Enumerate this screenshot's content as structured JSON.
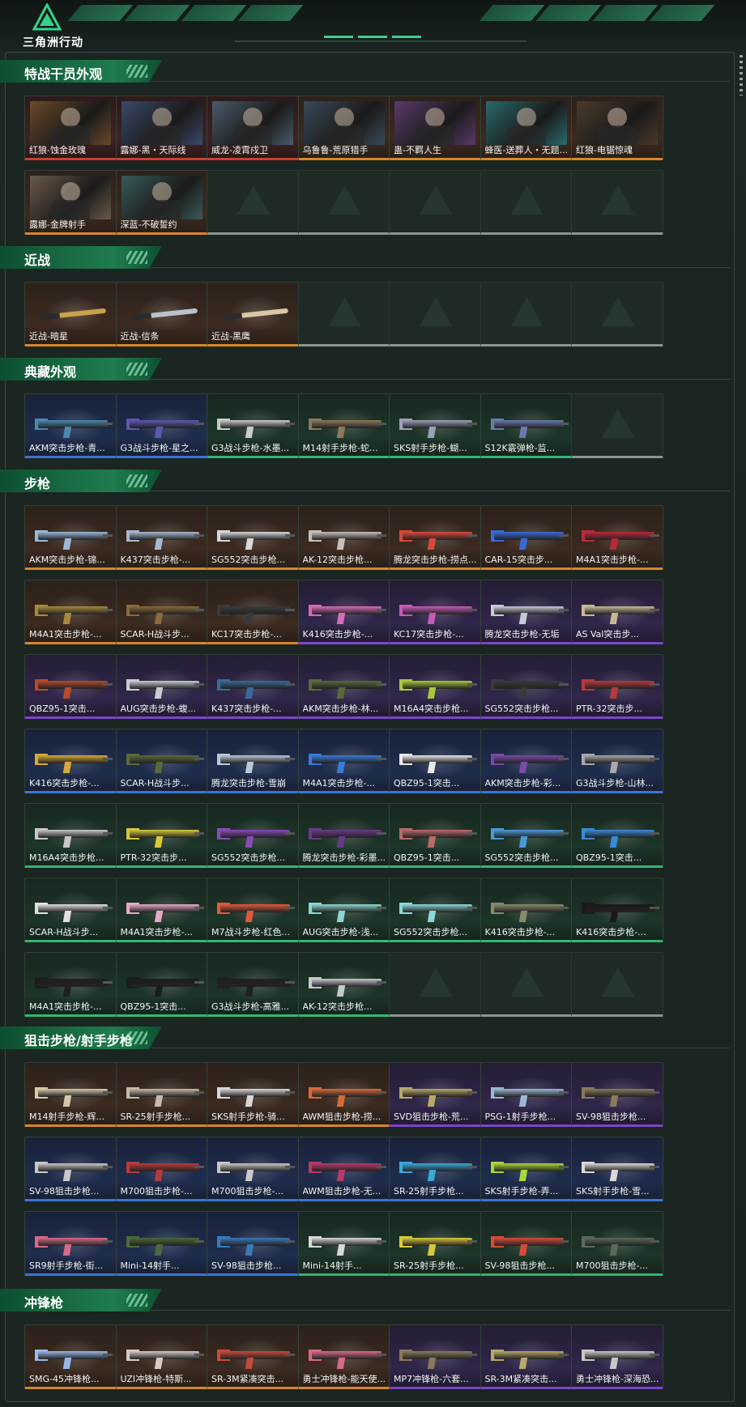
{
  "app": {
    "logo_text": "三角洲行动",
    "accent": "#2fd08a"
  },
  "rarity_colors": {
    "gold": "#d9862a",
    "red": "#c9402f",
    "purple": "#7c46c9",
    "blue": "#3a74d6",
    "green": "#32b771",
    "silver": "#9aa6a0"
  },
  "sections": [
    {
      "title": "特战干员外观",
      "kind": "portrait",
      "items": [
        {
          "label": "红狼-蚀金玫瑰",
          "rarity": "red",
          "icon": "operator-portrait",
          "tint": "#6a4a2a"
        },
        {
          "label": "露娜-黑・天际线",
          "rarity": "red",
          "icon": "operator-portrait",
          "tint": "#3a4a6a"
        },
        {
          "label": "威龙-凌霄戍卫",
          "rarity": "red",
          "icon": "operator-portrait",
          "tint": "#4a5a6a"
        },
        {
          "label": "乌鲁鲁-荒原猎手",
          "rarity": "gold",
          "icon": "operator-portrait",
          "tint": "#3a4a5a"
        },
        {
          "label": "蛊-不羁人生",
          "rarity": "gold",
          "icon": "operator-portrait",
          "tint": "#5a3a6a"
        },
        {
          "label": "蜂医-送葬人・无题...",
          "rarity": "gold",
          "icon": "operator-portrait",
          "tint": "#2a6a6a"
        },
        {
          "label": "红狼-电锯惊魂",
          "rarity": "gold",
          "icon": "operator-portrait",
          "tint": "#4a3a2a"
        },
        {
          "label": "露娜-金牌射手",
          "rarity": "gold",
          "icon": "operator-portrait",
          "tint": "#6a5a4a"
        },
        {
          "label": "深蓝-不破誓约",
          "rarity": "gold",
          "icon": "operator-portrait",
          "tint": "#3a5a5a"
        },
        {
          "label": "",
          "rarity": "empty"
        },
        {
          "label": "",
          "rarity": "empty"
        },
        {
          "label": "",
          "rarity": "empty"
        },
        {
          "label": "",
          "rarity": "empty"
        },
        {
          "label": "",
          "rarity": "empty"
        }
      ]
    },
    {
      "title": "近战",
      "kind": "knife",
      "items": [
        {
          "label": "近战-暗星",
          "rarity": "gold",
          "icon": "knife-icon",
          "tint": "#c9a24a"
        },
        {
          "label": "近战-信条",
          "rarity": "gold",
          "icon": "knife-icon",
          "tint": "#b9c2c8"
        },
        {
          "label": "近战-黑鹰",
          "rarity": "gold",
          "icon": "knife-icon",
          "tint": "#d8c8a8"
        },
        {
          "label": "",
          "rarity": "empty"
        },
        {
          "label": "",
          "rarity": "empty"
        },
        {
          "label": "",
          "rarity": "empty"
        },
        {
          "label": "",
          "rarity": "empty"
        }
      ]
    },
    {
      "title": "典藏外观",
      "kind": "gun",
      "items": [
        {
          "label": "AKM突击步枪-青...",
          "rarity": "blue",
          "icon": "rifle-icon",
          "tint": "#4a8ab0"
        },
        {
          "label": "G3战斗步枪-星之...",
          "rarity": "blue",
          "icon": "rifle-icon",
          "tint": "#5a5ab0"
        },
        {
          "label": "G3战斗步枪-水墨...",
          "rarity": "green",
          "icon": "rifle-icon",
          "tint": "#c8ccc8"
        },
        {
          "label": "M14射手步枪-蛇...",
          "rarity": "green",
          "icon": "rifle-icon",
          "tint": "#8a7a5a"
        },
        {
          "label": "SKS射手步枪-蝴...",
          "rarity": "green",
          "icon": "rifle-icon",
          "tint": "#9aa2b8"
        },
        {
          "label": "S12K霰弹枪-监...",
          "rarity": "green",
          "icon": "shotgun-icon",
          "tint": "#6a7ab0"
        },
        {
          "label": "",
          "rarity": "empty"
        }
      ]
    },
    {
      "title": "步枪",
      "kind": "gun",
      "items": [
        {
          "label": "AKM突击步枪-锦...",
          "rarity": "gold",
          "icon": "rifle-icon",
          "tint": "#9ab8d8"
        },
        {
          "label": "K437突击步枪-...",
          "rarity": "gold",
          "icon": "rifle-icon",
          "tint": "#a8b8d0"
        },
        {
          "label": "SG552突击步枪...",
          "rarity": "gold",
          "icon": "rifle-icon",
          "tint": "#d8d8d8"
        },
        {
          "label": "AK-12突击步枪...",
          "rarity": "gold",
          "icon": "rifle-icon",
          "tint": "#c8c0b8"
        },
        {
          "label": "腾龙突击步枪-捞点...",
          "rarity": "gold",
          "icon": "rifle-icon",
          "tint": "#d84a3a"
        },
        {
          "label": "CAR-15突击步...",
          "rarity": "gold",
          "icon": "rifle-icon",
          "tint": "#3a6ad8"
        },
        {
          "label": "M4A1突击步枪-...",
          "rarity": "gold",
          "icon": "rifle-icon",
          "tint": "#b82a3a"
        },
        {
          "label": "M4A1突击步枪-...",
          "rarity": "gold",
          "icon": "rifle-icon",
          "tint": "#a88a3a"
        },
        {
          "label": "SCAR-H战斗步...",
          "rarity": "gold",
          "icon": "rifle-icon",
          "tint": "#8a6a3a"
        },
        {
          "label": "KC17突击步枪-...",
          "rarity": "gold",
          "icon": "rifle-icon",
          "tint": "#3a3a3a"
        },
        {
          "label": "K416突击步枪-...",
          "rarity": "purple",
          "icon": "rifle-icon",
          "tint": "#d86ab8"
        },
        {
          "label": "KC17突击步枪-...",
          "rarity": "purple",
          "icon": "rifle-icon",
          "tint": "#c85ab8"
        },
        {
          "label": "腾龙突击步枪-无垢",
          "rarity": "purple",
          "icon": "rifle-icon",
          "tint": "#c8c8d8"
        },
        {
          "label": "AS Val突击步...",
          "rarity": "purple",
          "icon": "rifle-icon",
          "tint": "#c8b898"
        },
        {
          "label": "QBZ95-1突击...",
          "rarity": "purple",
          "icon": "rifle-icon",
          "tint": "#b84a2a"
        },
        {
          "label": "AUG突击步枪-蝮...",
          "rarity": "purple",
          "icon": "rifle-icon",
          "tint": "#c8ccd0"
        },
        {
          "label": "K437突击步枪-...",
          "rarity": "purple",
          "icon": "rifle-icon",
          "tint": "#3a6a9a"
        },
        {
          "label": "AKM突击步枪-林...",
          "rarity": "purple",
          "icon": "rifle-icon",
          "tint": "#5a6a3a"
        },
        {
          "label": "M16A4突击步枪...",
          "rarity": "purple",
          "icon": "rifle-icon",
          "tint": "#a8c83a"
        },
        {
          "label": "SG552突击步枪...",
          "rarity": "purple",
          "icon": "rifle-icon",
          "tint": "#3a3a3a"
        },
        {
          "label": "PTR-32突击步...",
          "rarity": "purple",
          "icon": "rifle-icon",
          "tint": "#b83a3a"
        },
        {
          "label": "K416突击步枪-...",
          "rarity": "blue",
          "icon": "rifle-icon",
          "tint": "#d8a83a"
        },
        {
          "label": "SCAR-H战斗步...",
          "rarity": "blue",
          "icon": "rifle-icon",
          "tint": "#5a6a3a"
        },
        {
          "label": "腾龙突击步枪-雪崩",
          "rarity": "blue",
          "icon": "rifle-icon",
          "tint": "#b8c8d8"
        },
        {
          "label": "M4A1突击步枪-...",
          "rarity": "blue",
          "icon": "rifle-icon",
          "tint": "#3a7ad8"
        },
        {
          "label": "QBZ95-1突击...",
          "rarity": "blue",
          "icon": "rifle-icon",
          "tint": "#e8e8e8"
        },
        {
          "label": "AKM突击步枪-彩...",
          "rarity": "blue",
          "icon": "rifle-icon",
          "tint": "#7a4aa8"
        },
        {
          "label": "G3战斗步枪-山林...",
          "rarity": "blue",
          "icon": "rifle-icon",
          "tint": "#a8a8a8"
        },
        {
          "label": "M16A4突击步枪...",
          "rarity": "green",
          "icon": "rifle-icon",
          "tint": "#c8c8c8"
        },
        {
          "label": "PTR-32突击步...",
          "rarity": "green",
          "icon": "rifle-icon",
          "tint": "#d8c83a"
        },
        {
          "label": "SG552突击步枪...",
          "rarity": "green",
          "icon": "rifle-icon",
          "tint": "#8a4ab8"
        },
        {
          "label": "腾龙突击步枪-彩墨...",
          "rarity": "green",
          "icon": "rifle-icon",
          "tint": "#6a3a8a"
        },
        {
          "label": "QBZ95-1突击...",
          "rarity": "green",
          "icon": "rifle-icon",
          "tint": "#b86a6a"
        },
        {
          "label": "SG552突击步枪...",
          "rarity": "green",
          "icon": "rifle-icon",
          "tint": "#4a9ad8"
        },
        {
          "label": "QBZ95-1突击...",
          "rarity": "green",
          "icon": "rifle-icon",
          "tint": "#3a8ad8"
        },
        {
          "label": "SCAR-H战斗步...",
          "rarity": "green",
          "icon": "rifle-icon",
          "tint": "#e0e0e0"
        },
        {
          "label": "M4A1突击步枪-...",
          "rarity": "green",
          "icon": "rifle-icon",
          "tint": "#e8a8c8"
        },
        {
          "label": "M7战斗步枪-红色...",
          "rarity": "green",
          "icon": "rifle-icon",
          "tint": "#e05a3a"
        },
        {
          "label": "AUG突击步枪-浅...",
          "rarity": "green",
          "icon": "rifle-icon",
          "tint": "#8ad8d0"
        },
        {
          "label": "SG552突击步枪...",
          "rarity": "green",
          "icon": "rifle-icon",
          "tint": "#8ad8d8"
        },
        {
          "label": "K416突击步枪-...",
          "rarity": "green",
          "icon": "rifle-icon",
          "tint": "#8a8a6a"
        },
        {
          "label": "K416突击步枪-...",
          "rarity": "green",
          "icon": "rifle-icon",
          "tint": "#1a1a1a"
        },
        {
          "label": "M4A1突击步枪-...",
          "rarity": "green",
          "icon": "rifle-icon",
          "tint": "#1e1e1e"
        },
        {
          "label": "QBZ95-1突击...",
          "rarity": "green",
          "icon": "rifle-icon",
          "tint": "#1c1c1c"
        },
        {
          "label": "G3战斗步枪-高雅...",
          "rarity": "green",
          "icon": "rifle-icon",
          "tint": "#202020"
        },
        {
          "label": "AK-12突击步枪...",
          "rarity": "green",
          "icon": "rifle-icon",
          "tint": "#c8c8d0"
        },
        {
          "label": "",
          "rarity": "empty"
        },
        {
          "label": "",
          "rarity": "empty"
        },
        {
          "label": "",
          "rarity": "empty"
        }
      ]
    },
    {
      "title": "狙击步枪/射手步枪",
      "kind": "gun",
      "items": [
        {
          "label": "M14射手步枪-辉...",
          "rarity": "gold",
          "icon": "sniper-icon",
          "tint": "#d8c8a8"
        },
        {
          "label": "SR-25射手步枪...",
          "rarity": "gold",
          "icon": "sniper-icon",
          "tint": "#c8b8a8"
        },
        {
          "label": "SKS射手步枪-骑...",
          "rarity": "gold",
          "icon": "sniper-icon",
          "tint": "#d8d8d8"
        },
        {
          "label": "AWM狙击步枪-捞...",
          "rarity": "gold",
          "icon": "sniper-icon",
          "tint": "#d86a3a"
        },
        {
          "label": "SVD狙击步枪-荒...",
          "rarity": "purple",
          "icon": "sniper-icon",
          "tint": "#b8a86a"
        },
        {
          "label": "PSG-1射手步枪...",
          "rarity": "purple",
          "icon": "sniper-icon",
          "tint": "#9ab8d8"
        },
        {
          "label": "SV-98狙击步枪...",
          "rarity": "purple",
          "icon": "sniper-icon",
          "tint": "#8a7a5a"
        },
        {
          "label": "SV-98狙击步枪...",
          "rarity": "blue",
          "icon": "sniper-icon",
          "tint": "#c8c8c8"
        },
        {
          "label": "M700狙击步枪-...",
          "rarity": "blue",
          "icon": "sniper-icon",
          "tint": "#b83a3a"
        },
        {
          "label": "M700狙击步枪-...",
          "rarity": "blue",
          "icon": "sniper-icon",
          "tint": "#c8c8c8"
        },
        {
          "label": "AWM狙击步枪-无...",
          "rarity": "blue",
          "icon": "sniper-icon",
          "tint": "#b83a6a"
        },
        {
          "label": "SR-25射手步枪...",
          "rarity": "blue",
          "icon": "sniper-icon",
          "tint": "#3aa8d8"
        },
        {
          "label": "SKS射手步枪-弄...",
          "rarity": "blue",
          "icon": "sniper-icon",
          "tint": "#a8d83a"
        },
        {
          "label": "SKS射手步枪-雪...",
          "rarity": "blue",
          "icon": "sniper-icon",
          "tint": "#d8d8d8"
        },
        {
          "label": "SR9射手步枪-街...",
          "rarity": "blue",
          "icon": "sniper-icon",
          "tint": "#d86a8a"
        },
        {
          "label": "Mini-14射手...",
          "rarity": "blue",
          "icon": "sniper-icon",
          "tint": "#4a6a3a"
        },
        {
          "label": "SV-98狙击步枪...",
          "rarity": "blue",
          "icon": "sniper-icon",
          "tint": "#3a7ab8"
        },
        {
          "label": "Mini-14射手...",
          "rarity": "green",
          "icon": "sniper-icon",
          "tint": "#d8d8d8"
        },
        {
          "label": "SR-25射手步枪...",
          "rarity": "green",
          "icon": "sniper-icon",
          "tint": "#d8c83a"
        },
        {
          "label": "SV-98狙击步枪...",
          "rarity": "green",
          "icon": "sniper-icon",
          "tint": "#d84a3a"
        },
        {
          "label": "M700狙击步枪-...",
          "rarity": "green",
          "icon": "sniper-icon",
          "tint": "#5a6a5a"
        }
      ]
    },
    {
      "title": "冲锋枪",
      "kind": "gun",
      "items": [
        {
          "label": "SMG-45冲锋枪...",
          "rarity": "gold",
          "icon": "smg-icon",
          "tint": "#9ab8e8"
        },
        {
          "label": "UZI冲锋枪-特斯...",
          "rarity": "gold",
          "icon": "smg-icon",
          "tint": "#d8c8c8"
        },
        {
          "label": "SR-3M紧凑突击...",
          "rarity": "gold",
          "icon": "smg-icon",
          "tint": "#c84a3a"
        },
        {
          "label": "勇士冲锋枪-能天使...",
          "rarity": "gold",
          "icon": "smg-icon",
          "tint": "#d86a8a"
        },
        {
          "label": "MP7冲锋枪-六套...",
          "rarity": "purple",
          "icon": "smg-icon",
          "tint": "#8a7a5a"
        },
        {
          "label": "SR-3M紧凑突击...",
          "rarity": "purple",
          "icon": "smg-icon",
          "tint": "#b8a86a"
        },
        {
          "label": "勇士冲锋枪-深海恐...",
          "rarity": "purple",
          "icon": "smg-icon",
          "tint": "#c8c8c8"
        }
      ]
    }
  ]
}
